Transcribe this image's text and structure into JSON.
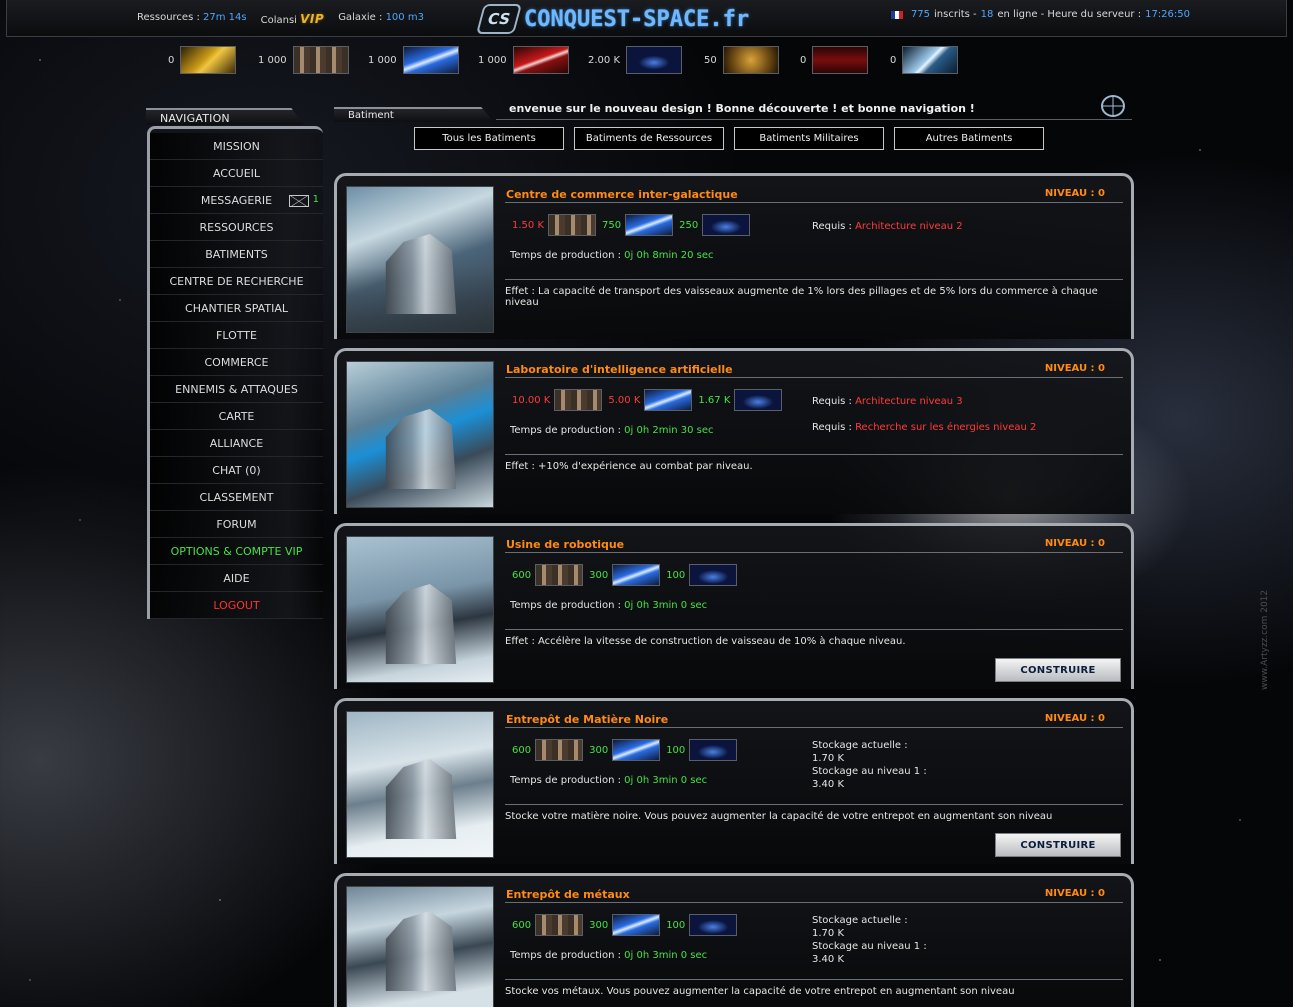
{
  "header": {
    "resources_label": "Ressources :",
    "resources_value": "27m 14s",
    "colony_label": "Colansi",
    "vip_label": "VIP",
    "galaxy_label": "Galaxie :",
    "galaxy_value": "100 m3",
    "logo_emblem": "CS",
    "logo_text": "CONQUEST-SPACE.fr",
    "registered_count": "775",
    "registered_label": "inscrits -",
    "online_count": "18",
    "online_label": "en ligne - Heure du serveur :",
    "server_time": "17:26:50"
  },
  "resources": [
    {
      "value": "0",
      "icon": "gold-ore-icon"
    },
    {
      "value": "1 000",
      "icon": "metal-crates-icon"
    },
    {
      "value": "1 000",
      "icon": "blue-crystal-icon"
    },
    {
      "value": "1 000",
      "icon": "red-crystal-icon"
    },
    {
      "value": "2.00 K",
      "icon": "energy-arc-icon"
    },
    {
      "value": "50",
      "icon": "population-icon"
    },
    {
      "value": "0",
      "icon": "red-weapon-icon"
    },
    {
      "value": "0",
      "icon": "cargo-icon"
    }
  ],
  "navigation": {
    "title": "NAVIGATION",
    "items": [
      "MISSION",
      "ACCUEIL",
      "MESSAGERIE",
      "RESSOURCES",
      "BATIMENTS",
      "CENTRE DE RECHERCHE",
      "CHANTIER SPATIAL",
      "FLOTTE",
      "COMMERCE",
      "ENNEMIS & ATTAQUES",
      "CARTE",
      "ALLIANCE",
      "CHAT (0)",
      "CLASSEMENT",
      "FORUM",
      "OPTIONS & COMPTE VIP",
      "AIDE",
      "LOGOUT"
    ],
    "message_count": "1"
  },
  "main": {
    "tab_label": "Batiment",
    "ticker": "envenue sur le nouveau design ! Bonne découverte ! et bonne navigation !",
    "filters": [
      "Tous les Batiments",
      "Batiments de Ressources",
      "Batiments Militaires",
      "Autres Batiments"
    ]
  },
  "common": {
    "prod_label": "Temps de production :",
    "req_label": "Requis :",
    "build_label": "CONSTRUIRE",
    "stock_current_label": "Stockage actuelle :",
    "stock_next_label": "Stockage au niveau 1 :"
  },
  "buildings": [
    {
      "title": "Centre de commerce inter-galactique",
      "level": "NIVEAU : 0",
      "costs": [
        {
          "v": "1.50 K",
          "ok": false
        },
        {
          "v": "750",
          "ok": true
        },
        {
          "v": "250",
          "ok": true
        }
      ],
      "prod_time": "0j 0h 8min 20 sec",
      "requirements": [
        "Architecture niveau 2"
      ],
      "effect": "Effet : La capacité de transport des vaisseaux augmente de 1% lors des pillages et de 5% lors du commerce à chaque niveau"
    },
    {
      "title": "Laboratoire d'intelligence artificielle",
      "level": "NIVEAU : 0",
      "costs": [
        {
          "v": "10.00 K",
          "ok": false
        },
        {
          "v": "5.00 K",
          "ok": false
        },
        {
          "v": "1.67 K",
          "ok": true
        }
      ],
      "prod_time": "0j 0h 2min 30 sec",
      "requirements": [
        "Architecture niveau 3",
        "Recherche sur les énergies niveau 2"
      ],
      "effect": "Effet : +10% d'expérience au combat par niveau."
    },
    {
      "title": "Usine de robotique",
      "level": "NIVEAU : 0",
      "costs": [
        {
          "v": "600",
          "ok": true
        },
        {
          "v": "300",
          "ok": true
        },
        {
          "v": "100",
          "ok": true
        }
      ],
      "prod_time": "0j 0h 3min 0 sec",
      "effect": "Effet : Accélère la vitesse de construction de vaisseau de 10% à chaque niveau."
    },
    {
      "title": "Entrepôt de Matière Noire",
      "level": "NIVEAU : 0",
      "costs": [
        {
          "v": "600",
          "ok": true
        },
        {
          "v": "300",
          "ok": true
        },
        {
          "v": "100",
          "ok": true
        }
      ],
      "prod_time": "0j 0h 3min 0 sec",
      "stock_current": "1.70 K",
      "stock_next": "3.40 K",
      "effect": "Stocke votre matière noire. Vous pouvez augmenter la capacité de votre entrepot en augmentant son niveau"
    },
    {
      "title": "Entrepôt de métaux",
      "level": "NIVEAU : 0",
      "costs": [
        {
          "v": "600",
          "ok": true
        },
        {
          "v": "300",
          "ok": true
        },
        {
          "v": "100",
          "ok": true
        }
      ],
      "prod_time": "0j 0h 3min 0 sec",
      "stock_current": "1.70 K",
      "stock_next": "3.40 K",
      "effect": "Stocke vos métaux. Vous pouvez augmenter la capacité de votre entrepot en augmentant son niveau"
    }
  ],
  "watermark": "www.Artyzz.com 2012"
}
